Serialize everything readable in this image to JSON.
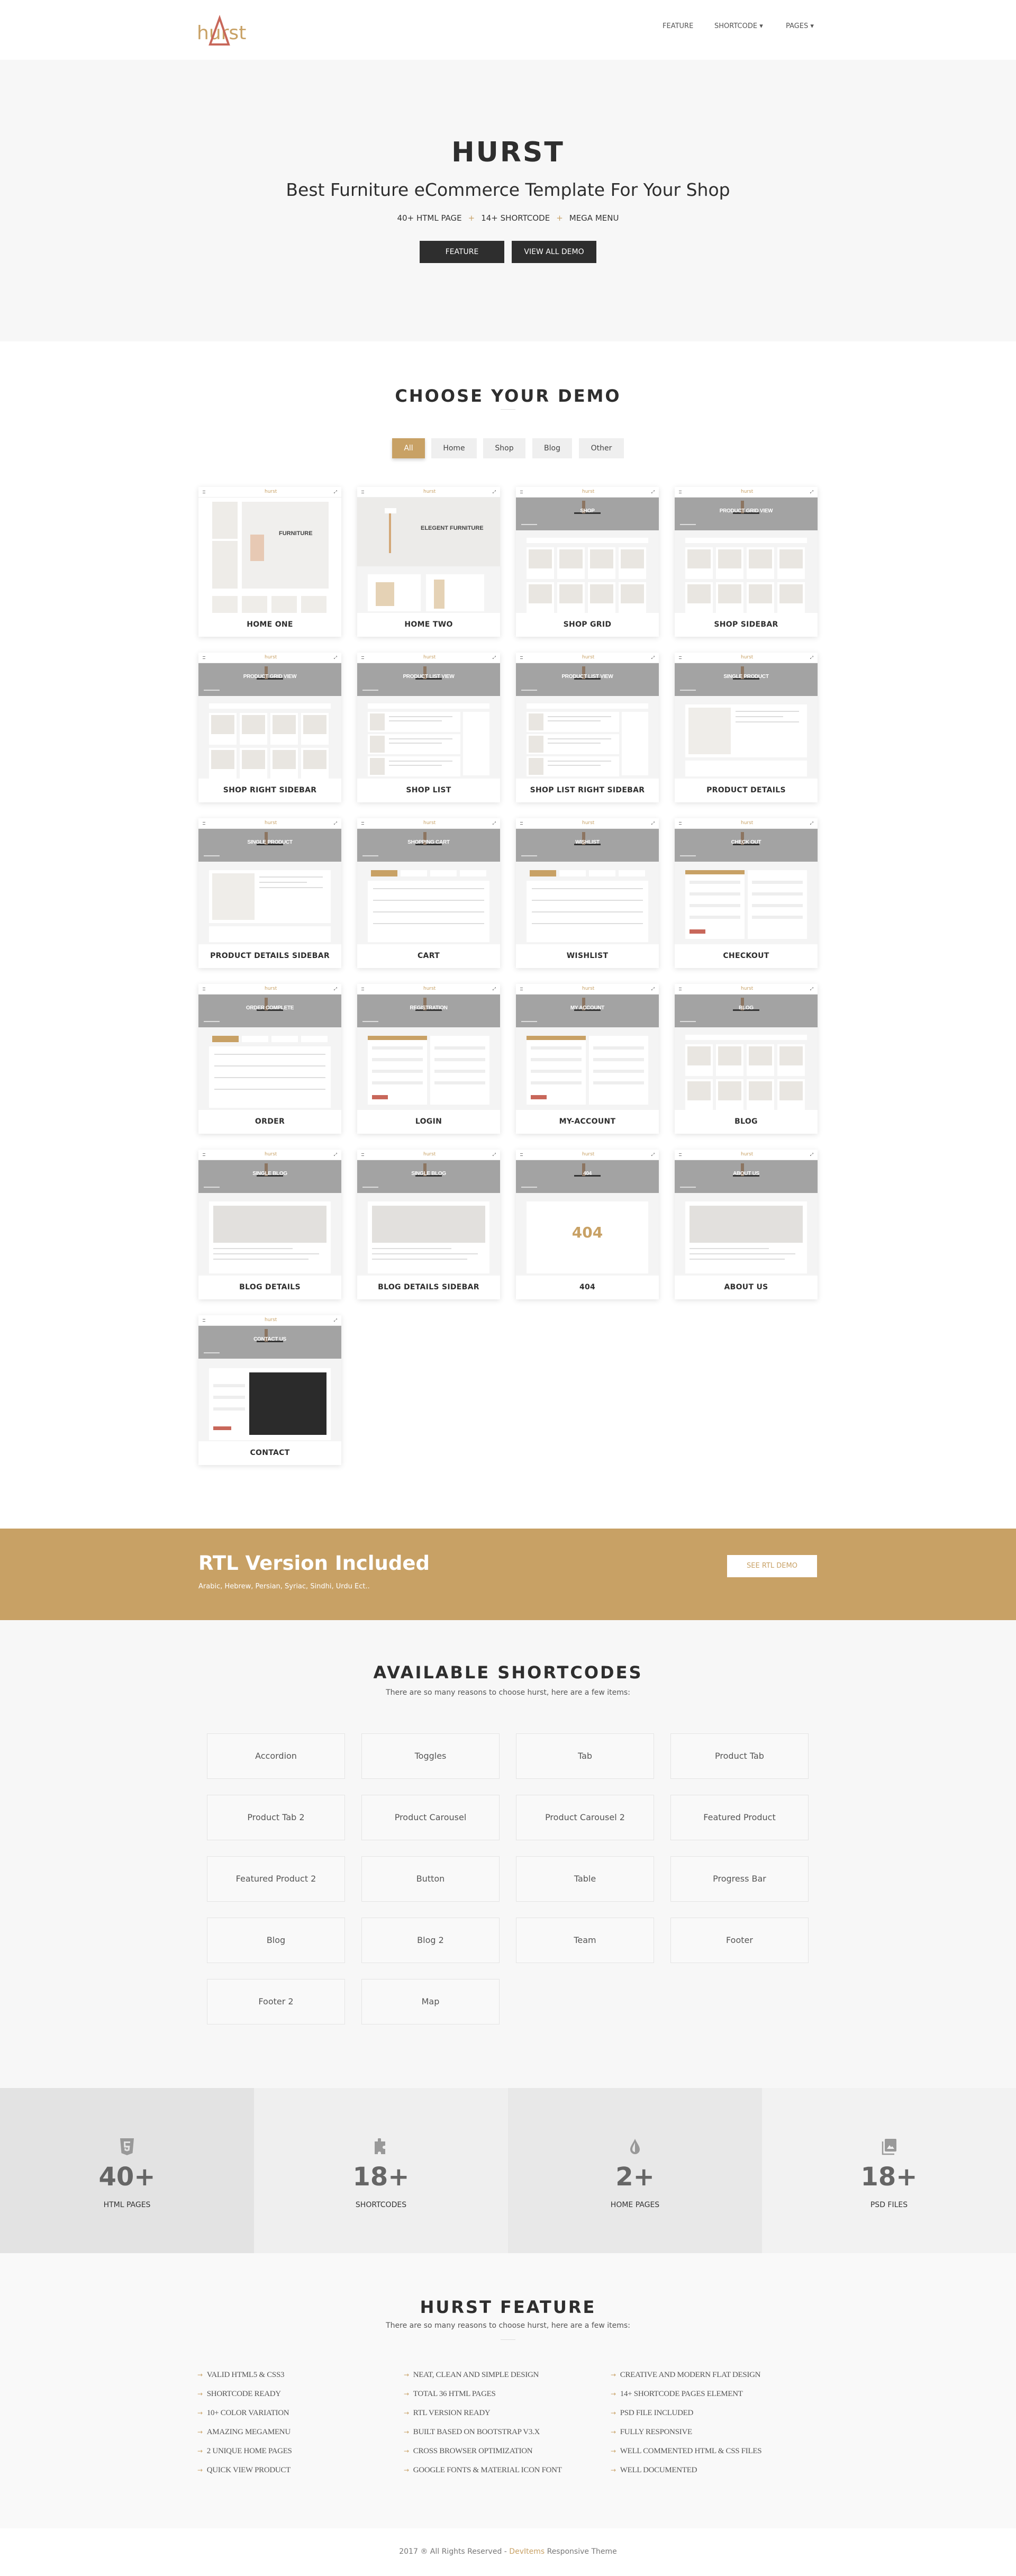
{
  "colors": {
    "accent": "#c8a165",
    "dark": "#2e2e2e",
    "logo_triangle": "#c8675a"
  },
  "header": {
    "logo": "hurst",
    "nav": [
      {
        "label": "FEATURE",
        "dropdown": false
      },
      {
        "label": "SHORTCODE",
        "dropdown": true
      },
      {
        "label": "PAGES",
        "dropdown": true
      }
    ]
  },
  "hero": {
    "title": "HURST",
    "subtitle": "Best Furniture eCommerce Template For Your Shop",
    "highlights": [
      "40+ HTML PAGE",
      "14+ SHORTCODE",
      "MEGA MENU"
    ],
    "separator": "+",
    "buttons": [
      "FEATURE",
      "VIEW ALL DEMO"
    ]
  },
  "demo": {
    "title": "CHOOSE YOUR DEMO",
    "filters": [
      {
        "label": "All",
        "active": true
      },
      {
        "label": "Home"
      },
      {
        "label": "Shop"
      },
      {
        "label": "Blog"
      },
      {
        "label": "Other"
      }
    ],
    "thumb_logo": "hurst",
    "items": [
      {
        "label": "HOME ONE",
        "kind": "home1",
        "banner": "FURNITURE"
      },
      {
        "label": "HOME TWO",
        "kind": "home2",
        "banner": "ELEGENT FURNITURE"
      },
      {
        "label": "SHOP GRID",
        "kind": "grid",
        "banner": "SHOP"
      },
      {
        "label": "SHOP SIDEBAR",
        "kind": "grid",
        "banner": "PRODUCT GRID VIEW"
      },
      {
        "label": "SHOP RIGHT SIDEBAR",
        "kind": "grid",
        "banner": "PRODUCT GRID VIEW"
      },
      {
        "label": "SHOP LIST",
        "kind": "list",
        "banner": "PRODUCT LIST VIEW"
      },
      {
        "label": "SHOP LIST RIGHT SIDEBAR",
        "kind": "list",
        "banner": "PRODUCT LIST VIEW"
      },
      {
        "label": "PRODUCT DETAILS",
        "kind": "detail",
        "banner": "SINGLE PRODUCT"
      },
      {
        "label": "PRODUCT DETAILS SIDEBAR",
        "kind": "detail",
        "banner": "SINGLE PRODUCT"
      },
      {
        "label": "CART",
        "kind": "table",
        "banner": "SHOPPING CART"
      },
      {
        "label": "WISHLIST",
        "kind": "table",
        "banner": "WISHLIST"
      },
      {
        "label": "CHECKOUT",
        "kind": "form",
        "banner": "CHECK OUT"
      },
      {
        "label": "ORDER",
        "kind": "table",
        "banner": "ORDER COMPLETE"
      },
      {
        "label": "LOGIN",
        "kind": "form",
        "banner": "REGISTRATION"
      },
      {
        "label": "MY-ACCOUNT",
        "kind": "form",
        "banner": "MY ACCOUNT"
      },
      {
        "label": "BLOG",
        "kind": "grid",
        "banner": "BLOG"
      },
      {
        "label": "BLOG DETAILS",
        "kind": "blog",
        "banner": "SINGLE BLOG"
      },
      {
        "label": "BLOG DETAILS SIDEBAR",
        "kind": "blog",
        "banner": "SINGLE BLOG"
      },
      {
        "label": "404",
        "kind": "e404",
        "banner": "404"
      },
      {
        "label": "ABOUT US",
        "kind": "blog",
        "banner": "ABOUT US"
      },
      {
        "label": "CONTACT",
        "kind": "contact",
        "banner": "CONTACT US"
      }
    ]
  },
  "rtl": {
    "title": "RTL Version Included",
    "subtitle": "Arabic, Hebrew, Persian, Syriac, Sindhi, Urdu Ect..",
    "button": "SEE RTL DEMO"
  },
  "shortcodes": {
    "title": "AVAILABLE SHORTCODES",
    "subtitle": "There are so many reasons to choose hurst, here are a few items:",
    "items": [
      "Accordion",
      "Toggles",
      "Tab",
      "Product Tab",
      "Product Tab 2",
      "Product Carousel",
      "Product Carousel 2",
      "Featured Product",
      "Featured Product 2",
      "Button",
      "Table",
      "Progress Bar",
      "Blog",
      "Blog 2",
      "Team",
      "Footer",
      "Footer 2",
      "Map"
    ]
  },
  "stats": [
    {
      "icon": "html5-icon",
      "value": "40+",
      "label": "HTML PAGES",
      "bg": "#e3e3e3"
    },
    {
      "icon": "puzzle-icon",
      "value": "18+",
      "label": "SHORTCODES",
      "bg": "#efefef"
    },
    {
      "icon": "drop-icon",
      "value": "2+",
      "label": "HOME PAGES",
      "bg": "#e8e8e8"
    },
    {
      "icon": "image-icon",
      "value": "18+",
      "label": "PSD FILES",
      "bg": "#f2f2f2"
    }
  ],
  "features": {
    "title": "HURST FEATURE",
    "subtitle": "There are so many reasons to choose hurst, here are a few items:",
    "columns": [
      [
        "VALID HTML5 & CSS3",
        "SHORTCODE READY",
        "10+ COLOR VARIATION",
        "AMAZING MEGAMENU",
        "2 UNIQUE HOME PAGES",
        "QUICK VIEW PRODUCT"
      ],
      [
        "NEAT, CLEAN AND SIMPLE DESIGN",
        "TOTAL 36 HTML PAGES",
        "RTL VERSION READY",
        "BUILT BASED ON BOOTSTRAP V3.X",
        "CROSS BROWSER OPTIMIZATION",
        "GOOGLE FONTS & MATERIAL ICON FONT"
      ],
      [
        "CREATIVE AND MODERN FLAT DESIGN",
        "14+ SHORTCODE PAGES ELEMENT",
        "PSD FILE INCLUDED",
        "FULLY RESPONSIVE",
        "WELL COMMENTED HTML & CSS FILES",
        "WELL DOCUMENTED"
      ]
    ]
  },
  "footer": {
    "prefix": "2017 ® All Rights Reserved - ",
    "brand": "DevItems",
    "suffix": " Responsive Theme"
  }
}
